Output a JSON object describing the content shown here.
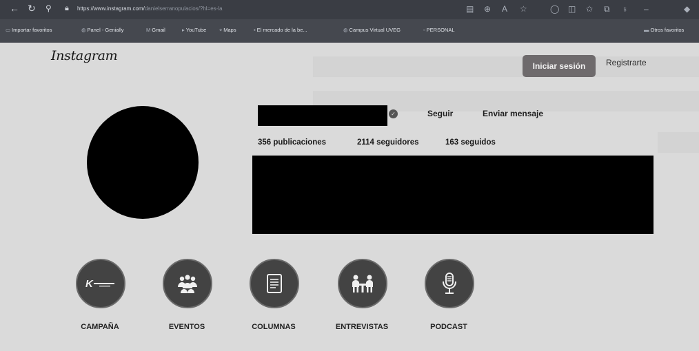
{
  "browser": {
    "url_host": "https://www.instagram.com/",
    "url_path": "danielserranopulacios/?hl=es-la",
    "bookmarks": [
      {
        "label": "Importar favoritos",
        "icon": "folder-icon"
      },
      {
        "label": "Panel - Genially",
        "icon": "globe-icon"
      },
      {
        "label": "Gmail",
        "icon": "mail-icon"
      },
      {
        "label": "YouTube",
        "icon": "youtube-icon"
      },
      {
        "label": "Maps",
        "icon": "map-icon"
      },
      {
        "label": "El mercado de la be...",
        "icon": "page-icon"
      },
      {
        "label": "Campus Virtual UVEG",
        "icon": "globe-icon"
      },
      {
        "label": "PERSONAL",
        "icon": "page-icon"
      }
    ],
    "other_favorites": "Otros favoritos"
  },
  "header": {
    "brand": "Instagram",
    "login_button": "Iniciar sesión",
    "register_link": "Registrarte"
  },
  "profile": {
    "follow_button": "Seguir",
    "message_button": "Enviar mensaje",
    "posts": "356 publicaciones",
    "followers": "2114 seguidores",
    "following": "163 seguidos"
  },
  "highlights": [
    {
      "label": "CAMPAÑA",
      "icon": "campaign-logo-icon"
    },
    {
      "label": "EVENTOS",
      "icon": "people-group-icon"
    },
    {
      "label": "COLUMNAS",
      "icon": "document-icon"
    },
    {
      "label": "ENTREVISTAS",
      "icon": "interview-icon"
    },
    {
      "label": "PODCAST",
      "icon": "microphone-icon"
    }
  ],
  "colors": {
    "browser_bar": "#3a3d44",
    "page_background": "#dadada",
    "login_button": "#6e6a6c",
    "highlight_circle": "#434343"
  }
}
